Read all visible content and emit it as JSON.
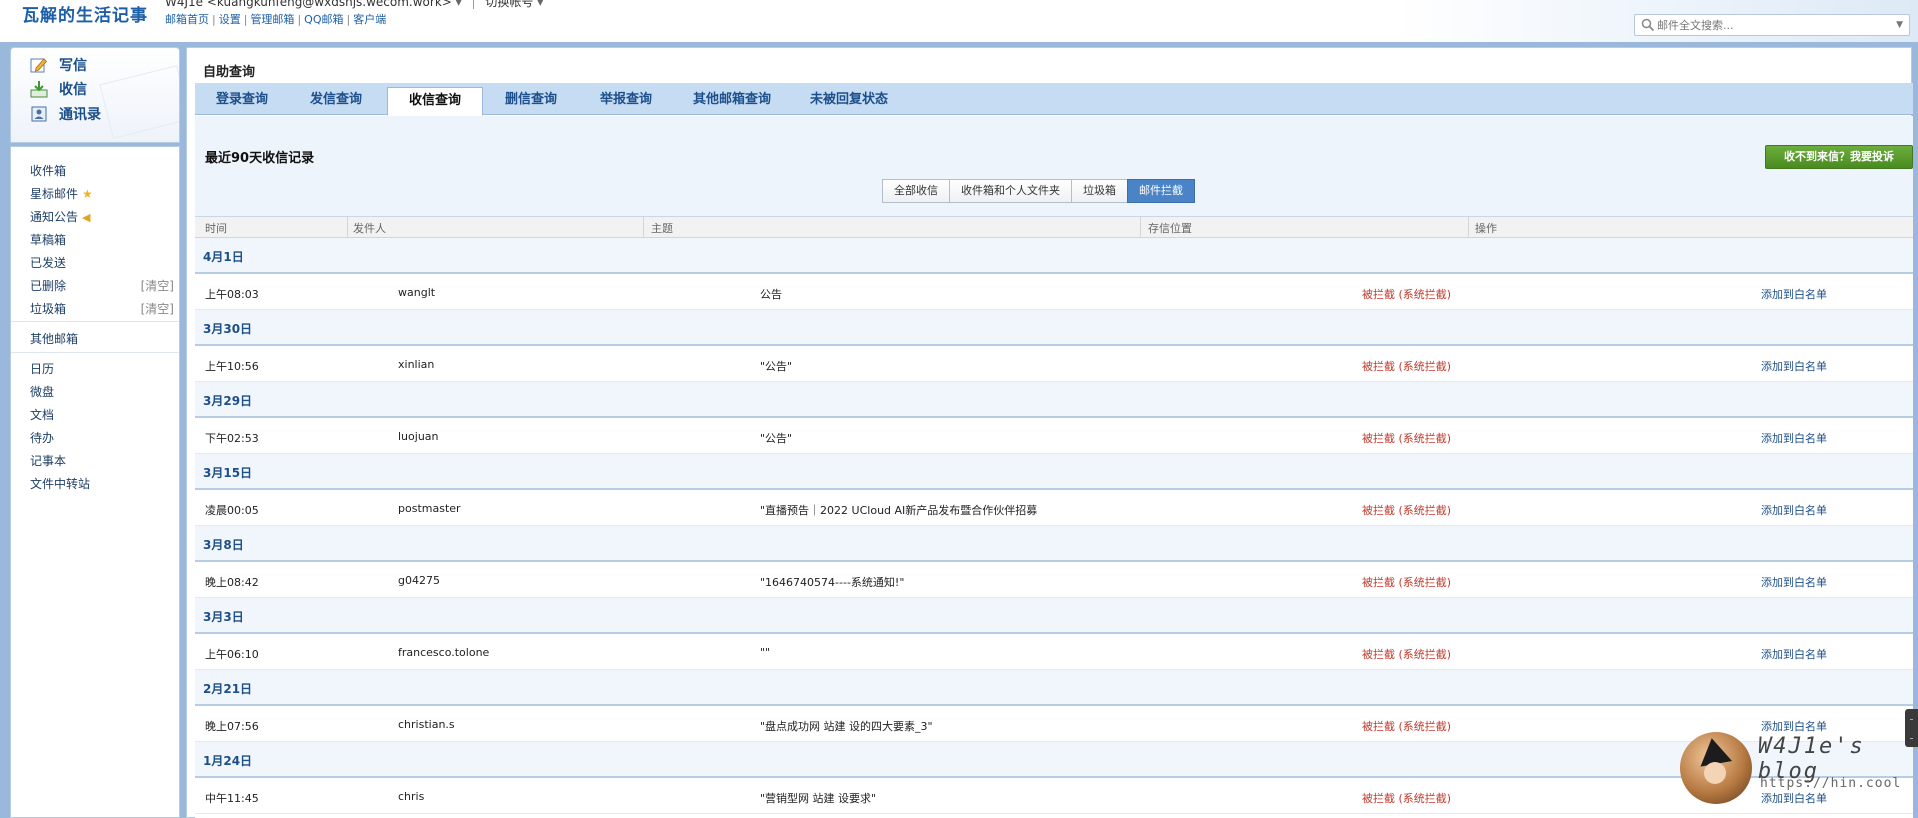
{
  "header": {
    "brand": "瓦解的生活记事",
    "account": "W4J1e <kuangkunfeng@wxdsnjs.wecom.work>",
    "account_switch": "切换帐号",
    "links": [
      "邮箱首页",
      "设置",
      "管理邮箱",
      "QQ邮箱",
      "客户端"
    ],
    "search_placeholder": "邮件全文搜索..."
  },
  "sidebar": {
    "quick": [
      "写信",
      "收信",
      "通讯录"
    ],
    "folders": [
      {
        "label": "收件箱"
      },
      {
        "label": "星标邮件",
        "icon": "star-icon"
      },
      {
        "label": "通知公告",
        "icon": "horn-icon"
      },
      {
        "label": "草稿箱"
      },
      {
        "label": "已发送"
      },
      {
        "label": "已删除",
        "action": "[清空]"
      },
      {
        "label": "垃圾箱",
        "action": "[清空]"
      }
    ],
    "other": "其他邮箱",
    "apps": [
      "日历",
      "微盘",
      "文档",
      "待办",
      "记事本",
      "文件中转站"
    ]
  },
  "main": {
    "title": "自助查询",
    "tabs": [
      "登录查询",
      "发信查询",
      "收信查询",
      "删信查询",
      "举报查询",
      "其他邮箱查询",
      "未被回复状态"
    ],
    "active_tab": 2,
    "section_title": "最近90天收信记录",
    "complain_button": "收不到来信？我要投诉",
    "filters": [
      "全部收信",
      "收件箱和个人文件夹",
      "垃圾箱",
      "邮件拦截"
    ],
    "active_filter": 3,
    "columns": [
      "时间",
      "发件人",
      "主题",
      "存信位置",
      "操作"
    ],
    "groups": [
      {
        "date": "4月1日",
        "time": "上午08:03",
        "from": "wanglt",
        "subject": "公告",
        "location": "被拦截 (系统拦截)",
        "action": "添加到白名单"
      },
      {
        "date": "3月30日",
        "time": "上午10:56",
        "from": "xinlian",
        "subject": "\"公告\"",
        "location": "被拦截 (系统拦截)",
        "action": "添加到白名单"
      },
      {
        "date": "3月29日",
        "time": "下午02:53",
        "from": "luojuan",
        "subject": "\"公告\"",
        "location": "被拦截 (系统拦截)",
        "action": "添加到白名单"
      },
      {
        "date": "3月15日",
        "time": "凌晨00:05",
        "from": "postmaster",
        "subject": "\"直播预告｜2022 UCloud AI新产品发布暨合作伙伴招募",
        "location": "被拦截 (系统拦截)",
        "action": "添加到白名单"
      },
      {
        "date": "3月8日",
        "time": "晚上08:42",
        "from": "g04275",
        "subject": "\"1646740574----系统通知!\"",
        "location": "被拦截 (系统拦截)",
        "action": "添加到白名单"
      },
      {
        "date": "3月3日",
        "time": "上午06:10",
        "from": "francesco.tolone",
        "subject": "\"\"",
        "location": "被拦截 (系统拦截)",
        "action": "添加到白名单"
      },
      {
        "date": "2月21日",
        "time": "晚上07:56",
        "from": "christian.s",
        "subject": "\"盘点成功网 站建 设的四大要素_3\"",
        "location": "被拦截 (系统拦截)",
        "action": "添加到白名单"
      },
      {
        "date": "1月24日",
        "time": "中午11:45",
        "from": "chris",
        "subject": "\"营销型网 站建 设要求\"",
        "location": "被拦截 (系统拦截)",
        "action": "添加到白名单"
      }
    ]
  },
  "watermark": {
    "name": "W4J1e's blog",
    "url": "https://hin.cool"
  }
}
